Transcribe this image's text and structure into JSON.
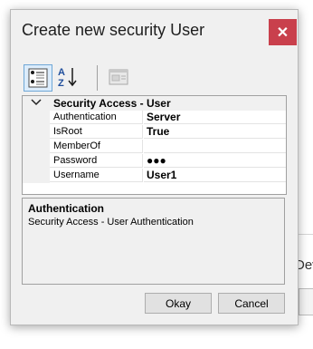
{
  "background": {
    "partial_text": "Dev"
  },
  "dialog": {
    "title": "Create new security User",
    "close_glyph": "✕"
  },
  "toolbar": {
    "buttons": [
      {
        "icon": "categorized-view-icon",
        "active": true
      },
      {
        "icon": "sort-alphabetical-icon",
        "label": "AZ"
      },
      {
        "icon": "property-pages-icon",
        "enabled": false
      }
    ]
  },
  "property_grid": {
    "category": "Security Access - User",
    "properties": [
      {
        "name": "Authentication",
        "value": "Server"
      },
      {
        "name": "IsRoot",
        "value": "True"
      },
      {
        "name": "MemberOf",
        "value": ""
      },
      {
        "name": "Password",
        "value": "●●●"
      },
      {
        "name": "Username",
        "value": "User1"
      }
    ]
  },
  "description": {
    "title": "Authentication",
    "text": "Security Access - User Authentication"
  },
  "buttons": {
    "okay": "Okay",
    "cancel": "Cancel"
  }
}
